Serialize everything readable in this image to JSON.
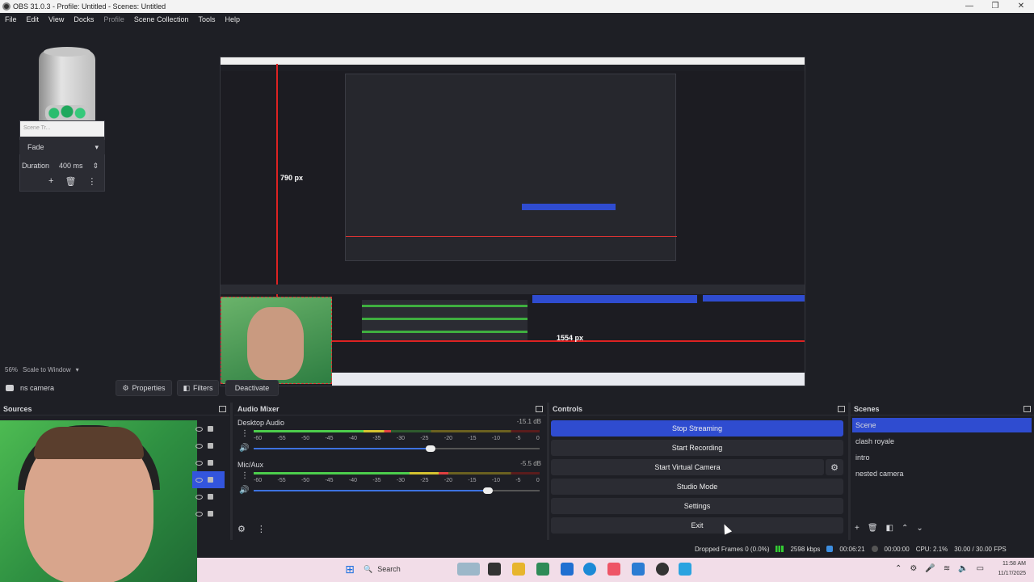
{
  "window": {
    "title": "OBS 31.0.3 - Profile: Untitled - Scenes: Untitled",
    "controls": [
      "—",
      "❐",
      "✕"
    ]
  },
  "menu": [
    "File",
    "Edit",
    "View",
    "Docks",
    "Profile",
    "Scene Collection",
    "Tools",
    "Help"
  ],
  "transitions": {
    "header": "Scene Tr...",
    "type": "Fade",
    "duration_label": "Duration",
    "duration_value": "400 ms"
  },
  "preview": {
    "label_vertical": "790 px",
    "label_horizontal": "1554 px"
  },
  "scale": {
    "percent": "56%",
    "mode": "Scale to Window"
  },
  "source_toolbar": {
    "selected_source": "ns camera",
    "properties_label": "Properties",
    "filters_label": "Filters",
    "deactivate_label": "Deactivate"
  },
  "docks": {
    "sources_title": "Sources",
    "audio_title": "Audio Mixer",
    "controls_title": "Controls",
    "scenes_title": "Scenes"
  },
  "audio": {
    "ticks": [
      "-60",
      "-55",
      "-50",
      "-45",
      "-40",
      "-35",
      "-30",
      "-25",
      "-20",
      "-15",
      "-10",
      "-5",
      "0"
    ],
    "channels": [
      {
        "name": "Desktop Audio",
        "db": "-15.1 dB",
        "level": 0.48,
        "volume": 0.62
      },
      {
        "name": "Mic/Aux",
        "db": "-5.5 dB",
        "level": 0.68,
        "volume": 0.82
      }
    ]
  },
  "controls": {
    "stop_streaming": "Stop Streaming",
    "start_recording": "Start Recording",
    "start_virtual_camera": "Start Virtual Camera",
    "studio_mode": "Studio Mode",
    "settings": "Settings",
    "exit": "Exit"
  },
  "scenes": [
    "Scene",
    "clash royale",
    "intro",
    "nested camera"
  ],
  "status": {
    "dropped_frames": "Dropped Frames 0 (0.0%)",
    "bitrate": "2598 kbps",
    "live_time": "00:06:21",
    "rec_time": "00:00:00",
    "cpu": "CPU: 2.1%",
    "fps": "30.00 / 30.00 FPS"
  },
  "taskbar": {
    "search_label": "Search",
    "time": "11:58 AM",
    "date": "11/17/2025"
  },
  "colors": {
    "accent": "#2f4cd0",
    "panel_bg": "#1e1f25",
    "button_bg": "#2b2c33"
  }
}
